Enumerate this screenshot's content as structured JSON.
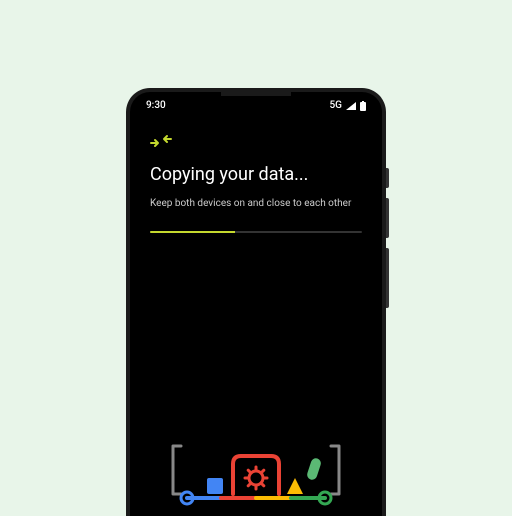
{
  "statusBar": {
    "time": "9:30",
    "network": "5G"
  },
  "icon": {
    "name": "transfer-arrows-icon"
  },
  "title": "Copying your data...",
  "subtitle": "Keep both devices on and close to each other",
  "progress": {
    "percent": 40
  },
  "colors": {
    "accent": "#c4d82e",
    "blue": "#4285f4",
    "red": "#ea4335",
    "yellow": "#fbbc04",
    "green": "#34a853",
    "greenPill": "#5bb974"
  }
}
